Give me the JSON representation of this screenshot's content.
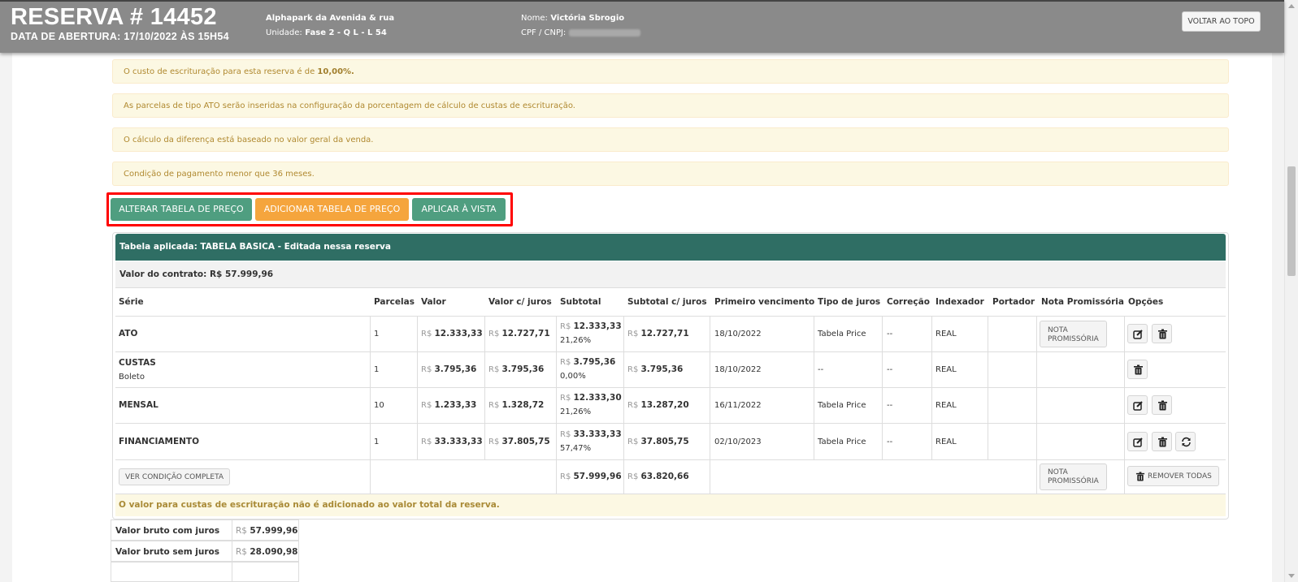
{
  "header": {
    "title": "RESERVA # 14452",
    "opened": "DATA DE ABERTURA: 17/10/2022 ÀS 15H54",
    "project": "Alphapark da Avenida & rua",
    "unit_label": "Unidade:",
    "unit_value": "Fase 2 - Q L - L 54",
    "name_label": "Nome:",
    "name_value": "Victória Sbrogio",
    "doc_label": "CPF / CNPJ:",
    "back_to_top": "VOLTAR AO TOPO"
  },
  "alerts": {
    "a1_text": "O custo de escrituração para esta reserva é de ",
    "a1_value": "10,00%.",
    "a2": "As parcelas de tipo ATO serão inseridas na configuração da porcentagem de cálculo de custas de escrituração.",
    "a3": "O cálculo da diferença está baseado no valor geral da venda.",
    "a4": "Condição de pagamento menor que 36 meses."
  },
  "actions": {
    "alter": "ALTERAR TABELA DE PREÇO",
    "add": "ADICIONAR TABELA DE PREÇO",
    "apply": "APLICAR À VISTA"
  },
  "table": {
    "applied": "Tabela aplicada: TABELA BASICA - Editada nessa reserva",
    "contract": "Valor do contrato: R$ 57.999,96",
    "currency": "R$",
    "columns": [
      "Série",
      "Parcelas",
      "Valor",
      "Valor c/ juros",
      "Subtotal",
      "Subtotal c/ juros",
      "Primeiro vencimento",
      "Tipo de juros",
      "Correção",
      "Indexador",
      "Portador",
      "Nota Promissória",
      "Opções"
    ],
    "rows": [
      {
        "serie": "ATO",
        "sub": "",
        "parcelas": "1",
        "valor": "12.333,33",
        "valor_juros": "12.727,71",
        "subtotal": "12.333,33",
        "pct": "21,26%",
        "subtotal_juros": "12.727,71",
        "vencimento": "18/10/2022",
        "tipo_juros": "Tabela Price",
        "correcao": "--",
        "indexador": "REAL",
        "nota_line1": "NOTA",
        "nota_line2": "PROMISSÓRIA"
      },
      {
        "serie": "CUSTAS",
        "sub": "Boleto",
        "parcelas": "1",
        "valor": "3.795,36",
        "valor_juros": "3.795,36",
        "subtotal": "3.795,36",
        "pct": "0,00%",
        "subtotal_juros": "3.795,36",
        "vencimento": "18/10/2022",
        "tipo_juros": "--",
        "correcao": "--",
        "indexador": "REAL"
      },
      {
        "serie": "MENSAL",
        "sub": "",
        "parcelas": "10",
        "valor": "1.233,33",
        "valor_juros": "1.328,72",
        "subtotal": "12.333,30",
        "pct": "21,26%",
        "subtotal_juros": "13.287,20",
        "vencimento": "16/11/2022",
        "tipo_juros": "Tabela Price",
        "correcao": "--",
        "indexador": "REAL"
      },
      {
        "serie": "FINANCIAMENTO",
        "sub": "",
        "parcelas": "1",
        "valor": "33.333,33",
        "valor_juros": "37.805,75",
        "subtotal": "33.333,33",
        "pct": "57,47%",
        "subtotal_juros": "37.805,75",
        "vencimento": "02/10/2023",
        "tipo_juros": "Tabela Price",
        "correcao": "--",
        "indexador": "REAL"
      }
    ],
    "footer": {
      "view_full": "VER CONDIÇÃO COMPLETA",
      "subtotal": "57.999,96",
      "subtotal_juros": "63.820,66",
      "nota_line1": "NOTA",
      "nota_line2": "PROMISSÓRIA",
      "remove_all": "REMOVER TODAS"
    },
    "warning": "O valor para custas de escrituração não é adicionado ao valor total da reserva."
  },
  "totals": [
    {
      "label": "Valor bruto com juros",
      "value": "57.999,96"
    },
    {
      "label": "Valor bruto sem juros",
      "value": "28.090,98"
    }
  ]
}
